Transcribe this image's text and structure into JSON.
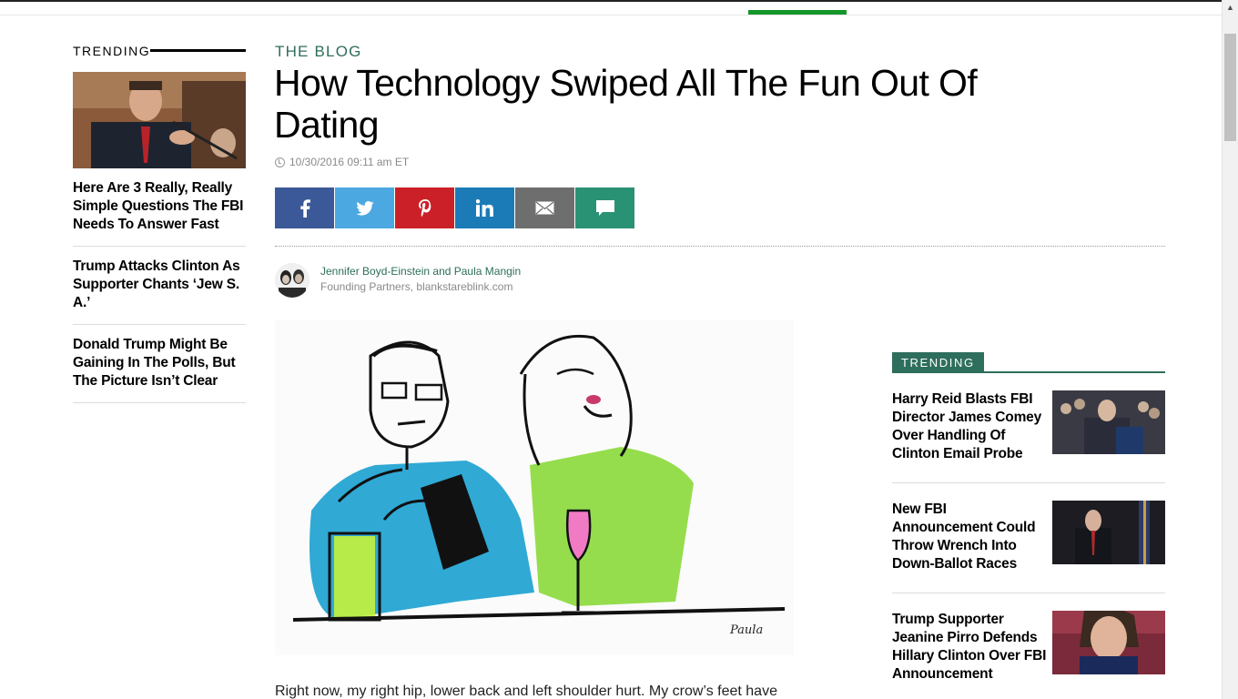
{
  "colors": {
    "accent_green": "#2e6e5c",
    "nav_green": "#15962b"
  },
  "left_trending": {
    "heading": "TRENDING",
    "items": [
      {
        "title": "Here Are 3 Really, Really Simple Questions The FBI Needs To Answer Fast"
      },
      {
        "title": "Trump Attacks Clinton As Supporter Chants ‘Jew S. A.’"
      },
      {
        "title": "Donald Trump Might Be Gaining In The Polls, But The Picture Isn’t Clear"
      }
    ]
  },
  "article": {
    "kicker": "THE BLOG",
    "title": "How Technology Swiped All The Fun Out Of Dating",
    "date": "10/30/2016 09:11 am ET",
    "author_name": "Jennifer Boyd-Einstein and Paula Mangin",
    "author_role": "Founding Partners, blankstareblink.com",
    "image_signature": "Paula",
    "body_first_line": "Right now, my right hip, lower back and left shoulder hurt. My crow’s feet have"
  },
  "share": {
    "icons": [
      "facebook-icon",
      "twitter-icon",
      "pinterest-icon",
      "linkedin-icon",
      "email-icon",
      "comment-icon"
    ]
  },
  "right_trending": {
    "heading": "TRENDING",
    "items": [
      {
        "title": "Harry Reid Blasts FBI Director James Comey Over Handling Of Clinton Email Probe"
      },
      {
        "title": "New FBI Announcement Could Throw Wrench Into Down-Ballot Races"
      },
      {
        "title": "Trump Supporter Jeanine Pirro Defends Hillary Clinton Over FBI Announcement"
      }
    ]
  }
}
